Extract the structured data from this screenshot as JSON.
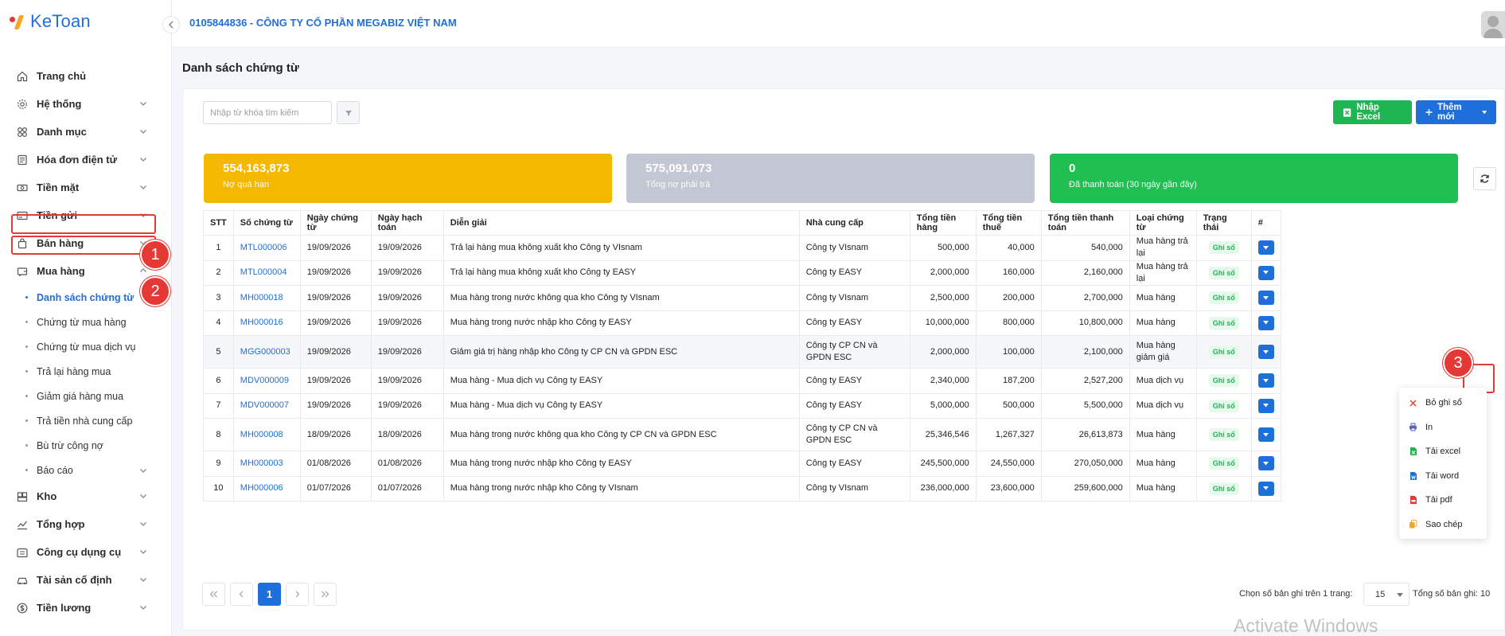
{
  "app": {
    "logo_text": "KeToan"
  },
  "topbar": {
    "company": "0105844836 - CÔNG TY CỔ PHẦN MEGABIZ VIỆT NAM"
  },
  "sidebar": {
    "items": [
      {
        "label": "Trang chủ",
        "icon": "home-icon"
      },
      {
        "label": "Hệ thống",
        "icon": "gear-icon"
      },
      {
        "label": "Danh mục",
        "icon": "grid-icon"
      },
      {
        "label": "Hóa đơn điện tử",
        "icon": "invoice-icon"
      },
      {
        "label": "Tiền mặt",
        "icon": "cash-icon"
      },
      {
        "label": "Tiền gửi",
        "icon": "bank-card-icon"
      },
      {
        "label": "Bán hàng",
        "icon": "bag-icon"
      },
      {
        "label": "Mua hàng",
        "icon": "cart-icon"
      }
    ],
    "purchase_sub": [
      "Danh sách chứng từ",
      "Chứng từ mua hàng",
      "Chứng từ mua dịch vụ",
      "Trả lại hàng mua",
      "Giảm giá hàng mua",
      "Trả tiền nhà cung cấp",
      "Bù trừ công nợ",
      "Báo cáo"
    ],
    "items_after": [
      {
        "label": "Kho",
        "icon": "warehouse-icon"
      },
      {
        "label": "Tổng hợp",
        "icon": "chart-line-icon"
      },
      {
        "label": "Công cụ dụng cụ",
        "icon": "tools-icon"
      },
      {
        "label": "Tài sản cố định",
        "icon": "car-icon"
      },
      {
        "label": "Tiền lương",
        "icon": "dollar-icon"
      }
    ]
  },
  "steps": {
    "one": "1",
    "two": "2",
    "three": "3"
  },
  "page": {
    "title": "Danh sách chứng từ"
  },
  "toolbar": {
    "search_placeholder": "Nhập từ khóa tìm kiếm",
    "import_excel": "Nhập Excel",
    "add_new": "Thêm mới"
  },
  "stats": [
    {
      "value": "554,163,873",
      "label": "Nợ quá hạn",
      "color": "#f5b800"
    },
    {
      "value": "575,091,073",
      "label": "Tổng nợ phải trả",
      "color": "#c3c6d3"
    },
    {
      "value": "0",
      "label": "Đã thanh toán (30 ngày gần đây)",
      "color": "#1fbf52"
    }
  ],
  "table": {
    "headers": [
      "STT",
      "Số chứng từ",
      "Ngày chứng từ",
      "Ngày hạch toán",
      "Diễn giải",
      "Nhà cung cấp",
      "Tổng tiền hàng",
      "Tổng tiền thuế",
      "Tổng tiền thanh toán",
      "Loại chứng từ",
      "Trạng thái",
      "#"
    ],
    "rows": [
      [
        "1",
        "MTL000006",
        "19/09/2026",
        "19/09/2026",
        "Trả lại hàng mua không xuất kho Công ty VIsnam",
        "Công ty VIsnam",
        "500,000",
        "40,000",
        "540,000",
        "Mua hàng trả lại",
        "Ghi sổ"
      ],
      [
        "2",
        "MTL000004",
        "19/09/2026",
        "19/09/2026",
        "Trả lại hàng mua không xuất kho Công ty EASY",
        "Công ty EASY",
        "2,000,000",
        "160,000",
        "2,160,000",
        "Mua hàng trả lại",
        "Ghi sổ"
      ],
      [
        "3",
        "MH000018",
        "19/09/2026",
        "19/09/2026",
        "Mua hàng trong nước không qua kho Công ty VIsnam",
        "Công ty VIsnam",
        "2,500,000",
        "200,000",
        "2,700,000",
        "Mua hàng",
        "Ghi sổ"
      ],
      [
        "4",
        "MH000016",
        "19/09/2026",
        "19/09/2026",
        "Mua hàng trong nước nhập kho Công ty EASY",
        "Công ty EASY",
        "10,000,000",
        "800,000",
        "10,800,000",
        "Mua hàng",
        "Ghi sổ"
      ],
      [
        "5",
        "MGG000003",
        "19/09/2026",
        "19/09/2026",
        "Giảm giá trị hàng nhập kho Công ty CP CN và GPDN ESC",
        "Công ty CP CN và GPDN ESC",
        "2,000,000",
        "100,000",
        "2,100,000",
        "Mua hàng giảm giá",
        "Ghi sổ"
      ],
      [
        "6",
        "MDV000009",
        "19/09/2026",
        "19/09/2026",
        "Mua hàng - Mua dịch vụ Công ty EASY",
        "Công ty EASY",
        "2,340,000",
        "187,200",
        "2,527,200",
        "Mua dịch vụ",
        "Ghi sổ"
      ],
      [
        "7",
        "MDV000007",
        "19/09/2026",
        "19/09/2026",
        "Mua hàng - Mua dịch vụ Công ty EASY",
        "Công ty EASY",
        "5,000,000",
        "500,000",
        "5,500,000",
        "Mua dịch vụ",
        "Ghi sổ"
      ],
      [
        "8",
        "MH000008",
        "18/09/2026",
        "18/09/2026",
        "Mua hàng trong nước không qua kho Công ty CP CN và GPDN ESC",
        "Công ty CP CN và GPDN ESC",
        "25,346,546",
        "1,267,327",
        "26,613,873",
        "Mua hàng",
        "Ghi sổ"
      ],
      [
        "9",
        "MH000003",
        "01/08/2026",
        "01/08/2026",
        "Mua hàng trong nước nhập kho Công ty EASY",
        "Công ty EASY",
        "245,500,000",
        "24,550,000",
        "270,050,000",
        "Mua hàng",
        "Ghi sổ"
      ],
      [
        "10",
        "MH000006",
        "01/07/2026",
        "01/07/2026",
        "Mua hàng trong nước nhập kho Công ty VIsnam",
        "Công ty VIsnam",
        "236,000,000",
        "23,600,000",
        "259,600,000",
        "Mua hàng",
        "Ghi sổ"
      ]
    ]
  },
  "dropdown": {
    "items": [
      {
        "label": "Bỏ ghi sổ",
        "icon": "x-icon",
        "color": "#e53935"
      },
      {
        "label": "In",
        "icon": "printer-icon",
        "color": "#5b5fc7"
      },
      {
        "label": "Tải excel",
        "icon": "excel-file-icon",
        "color": "#1fb552"
      },
      {
        "label": "Tải word",
        "icon": "word-file-icon",
        "color": "#1e6fd9"
      },
      {
        "label": "Tải pdf",
        "icon": "pdf-file-icon",
        "color": "#e53935"
      },
      {
        "label": "Sao chép",
        "icon": "copy-icon",
        "color": "#f5a623"
      }
    ]
  },
  "pagination": {
    "current": "1",
    "per_page_label": "Chọn số bản ghi trên 1 trang:",
    "per_page": "15",
    "total_label": "Tổng số bản ghi:",
    "total": "10"
  },
  "watermark": "Activate Windows"
}
